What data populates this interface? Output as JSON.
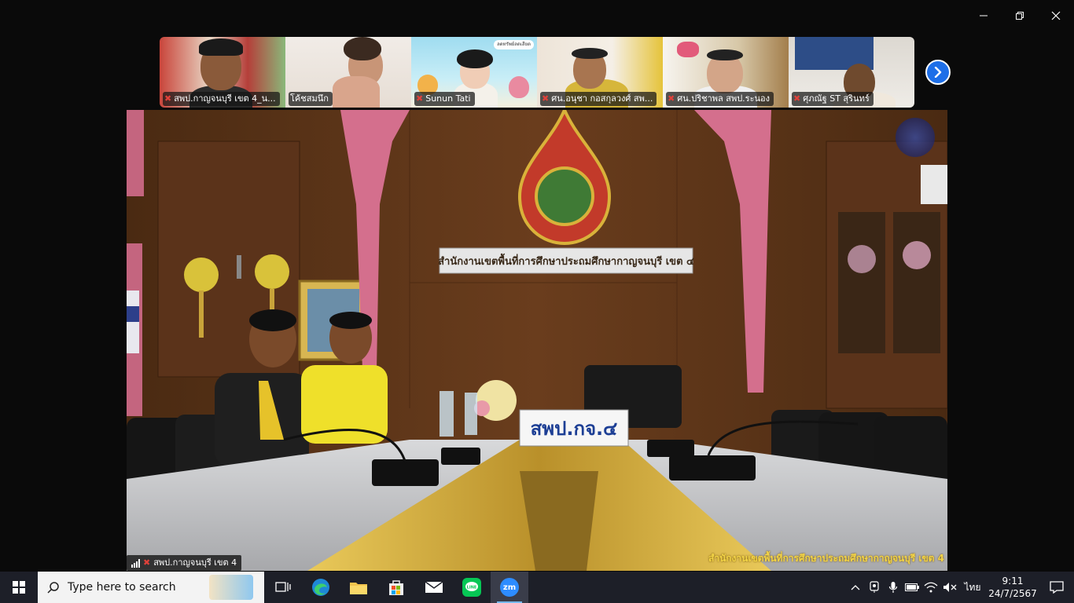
{
  "participants": [
    {
      "label": "สพป.กาญจนบุรี เขต 4_น...",
      "muted": true
    },
    {
      "label": "โค้ชสมนึก",
      "muted": false
    },
    {
      "label": "Sunun Tati",
      "muted": true,
      "logo_text": "ลดทรัพย์ลดเสียด"
    },
    {
      "label": "ศน.อนุชา กอสกุลวงศ์ สพ...",
      "muted": true
    },
    {
      "label": "ศน.ปริชาพล สพป.ระนอง",
      "muted": true
    },
    {
      "label": "ศุภณัฐ ST สุรินทร์",
      "muted": true
    }
  ],
  "main_video": {
    "sign_text": "สำนักงานเขตพื้นที่การศึกษาประถมศึกษากาญจนบุรี เขต ๔",
    "nameplate": "สพป.กจ.๔",
    "watermark": "สำนักงานเขตพื้นที่การศึกษาประถมศึกษากาญจนบุรี เขต 4",
    "speaker_name": "สพป.กาญจนบุรี เขต 4"
  },
  "taskbar": {
    "search_placeholder": "Type here to search",
    "language": "ไทย",
    "time": "9:11",
    "date": "24/7/2567",
    "zoom_label": "zm"
  },
  "colors": {
    "taskbar": "#1d1f28",
    "accent": "#1e6fe8",
    "wood": "#5a3318",
    "gold": "#d9b23a"
  }
}
